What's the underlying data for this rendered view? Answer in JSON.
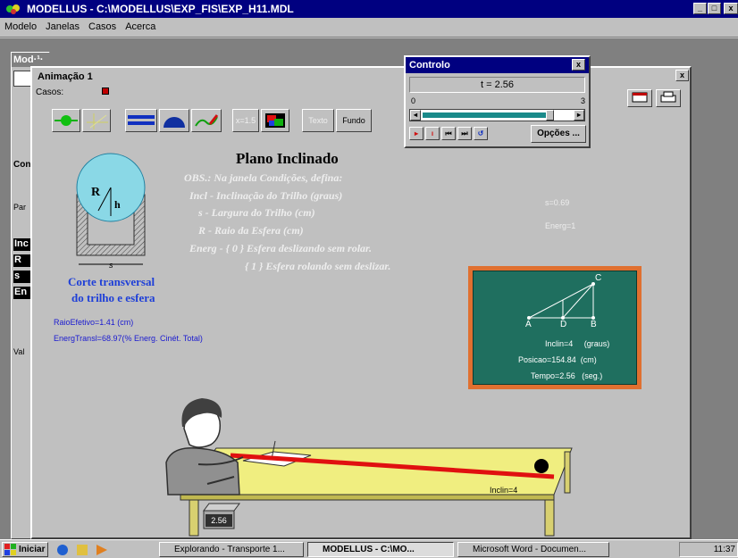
{
  "titlebar": {
    "title": "MODELLUS - C:\\MODELLUS\\EXP_FIS\\EXP_H11.MDL",
    "min": "_",
    "max": "□",
    "close": "x"
  },
  "menu": [
    {
      "label": "Modelo"
    },
    {
      "label": "Janelas"
    },
    {
      "label": "Casos"
    },
    {
      "label": "Acerca"
    }
  ],
  "model_window": {
    "title": "Mod·¹·",
    "con_label": "Con",
    "par_label": "Par",
    "vars": [
      "Inc",
      "R",
      "s",
      "En"
    ],
    "val_label": "Val"
  },
  "animation": {
    "title": "Animação 1",
    "casos_label": "Casos:",
    "toolbar": {
      "scale_label": "x=1.5",
      "texto_label": "Texto",
      "fundo_label": "Fundo"
    },
    "heading": "Plano Inclinado",
    "obs_lines": [
      "OBS.: Na janela Condições, defina:",
      "Incl - Inclinação do Trilho (graus)",
      "s - Largura do Trilho (cm)",
      "R - Raio da Esfera (cm)",
      "Energ - { 0 } Esfera deslizando sem rolar.",
      "{ 1 } Esfera rolando sem deslizar."
    ],
    "cross_section": {
      "r_label": "R",
      "h_label": "h",
      "s_label": "s",
      "caption_1": "Corte transversal",
      "caption_2": "do trilho e esfera"
    },
    "raio_efetivo": "RaioEfetivo=1.41  (cm)",
    "energ_transl": "EnergTransl=68.97(% Energ. Cinét. Total)",
    "s_value": "s=0.69",
    "energ_value": "Energ=1",
    "board": {
      "c_label": "C",
      "a_label": "A",
      "d_label": "D",
      "b_label": "B",
      "inclin_line": "Inclin=4     (graus)",
      "posicao_line": "Posicao=154.84  (cm)",
      "tempo_line": "Tempo=2.56   (seg.)"
    },
    "timer_display": "2.56",
    "ramp_label": "Inclin=4"
  },
  "controlo": {
    "title": "Controlo",
    "t_display": "t =  2.56",
    "scale_min": "0",
    "scale_max": "3",
    "progress": 0.853,
    "opcoes_label": "Opções ..."
  },
  "taskbar": {
    "start_label": "Iniciar",
    "tasks": [
      {
        "label": "Explorando - Transporte 1..."
      },
      {
        "label": "MODELLUS - C:\\MO..."
      },
      {
        "label": "Microsoft Word - Documen..."
      }
    ],
    "clock": "11:37"
  },
  "colors": {
    "title_blue": "#000080",
    "board_green": "#1f6f5f",
    "board_frame": "#e07030",
    "table_yellow": "#f0ee80",
    "ramp_red": "#e01010",
    "sphere_cyan": "#8ad8e6"
  }
}
